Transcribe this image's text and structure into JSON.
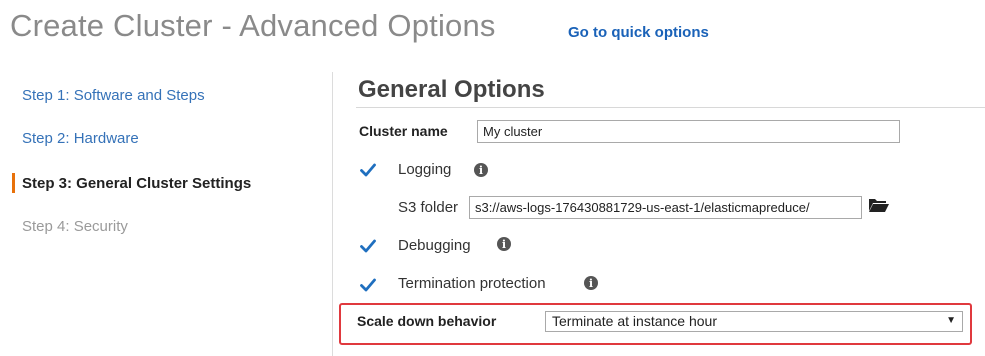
{
  "header": {
    "title": "Create Cluster - Advanced Options",
    "quick_options_link": "Go to quick options"
  },
  "steps": [
    {
      "label": "Step 1: Software and Steps",
      "state": "link"
    },
    {
      "label": "Step 2: Hardware",
      "state": "link"
    },
    {
      "label": "Step 3: General Cluster Settings",
      "state": "active"
    },
    {
      "label": "Step 4: Security",
      "state": "disabled"
    }
  ],
  "general_options": {
    "title": "General Options",
    "cluster_name": {
      "label": "Cluster name",
      "value": "My cluster"
    },
    "logging": {
      "label": "Logging",
      "checked": true
    },
    "s3_folder": {
      "label": "S3 folder",
      "value": "s3://aws-logs-176430881729-us-east-1/elasticmapreduce/"
    },
    "debugging": {
      "label": "Debugging",
      "checked": true
    },
    "termination_protection": {
      "label": "Termination protection",
      "checked": true
    },
    "scale_down": {
      "label": "Scale down behavior",
      "selected": "Terminate at instance hour"
    }
  },
  "colors": {
    "accent": "#e8710a",
    "link": "#3572b8",
    "checkbox": "#1f6fbf",
    "highlight": "#e0393e"
  },
  "icons": {
    "info": "info-circle-icon",
    "folder": "folder-open-icon",
    "check": "checkmark-icon",
    "dropdown": "caret-down-icon"
  }
}
